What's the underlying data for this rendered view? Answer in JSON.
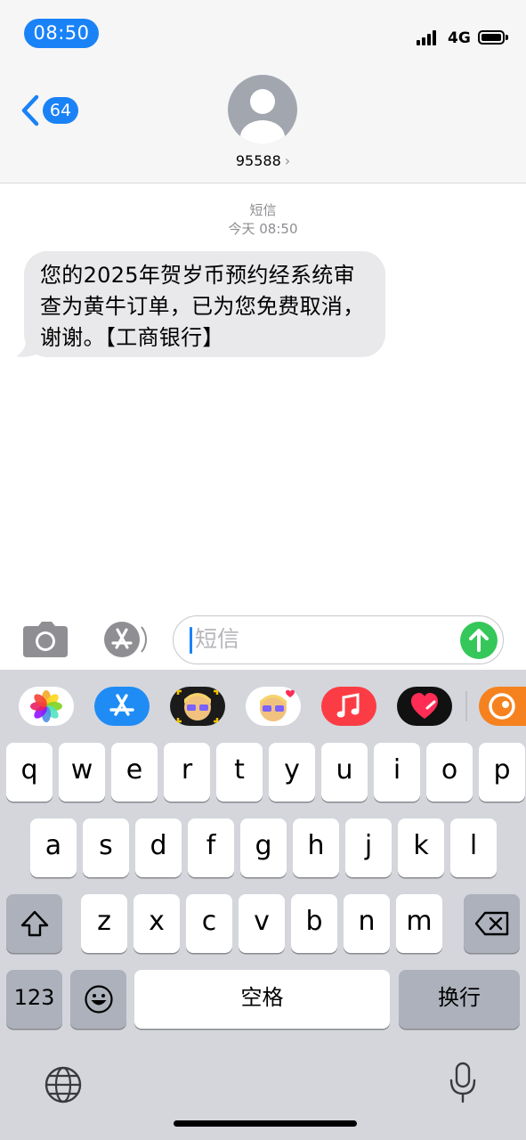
{
  "status_bar": {
    "time": "08:50",
    "network": "4G"
  },
  "header": {
    "back_count": "64",
    "contact_name": "95588",
    "contact_chevron": "›"
  },
  "thread": {
    "label": "短信",
    "timestamp": "今天 08:50",
    "messages": [
      {
        "text": "您的2025年贺岁币预约经系统审查为黄牛订单，已为您免费取消，谢谢。【工商银行】",
        "incoming": true
      }
    ]
  },
  "input": {
    "placeholder": "短信"
  },
  "app_drawer": [
    "photos-icon",
    "app-store-icon",
    "memoji-icon",
    "memoji-stickers-icon",
    "music-icon",
    "digital-touch-icon",
    "uc-browser-icon"
  ],
  "keyboard": {
    "row1": [
      "q",
      "w",
      "e",
      "r",
      "t",
      "y",
      "u",
      "i",
      "o",
      "p"
    ],
    "row2": [
      "a",
      "s",
      "d",
      "f",
      "g",
      "h",
      "j",
      "k",
      "l"
    ],
    "row3": [
      "z",
      "x",
      "c",
      "v",
      "b",
      "n",
      "m"
    ],
    "numbers_label": "123",
    "space_label": "空格",
    "return_label": "换行"
  },
  "colors": {
    "accent": "#1a82f7",
    "send": "#35c759",
    "bubble": "#e9e9eb"
  }
}
